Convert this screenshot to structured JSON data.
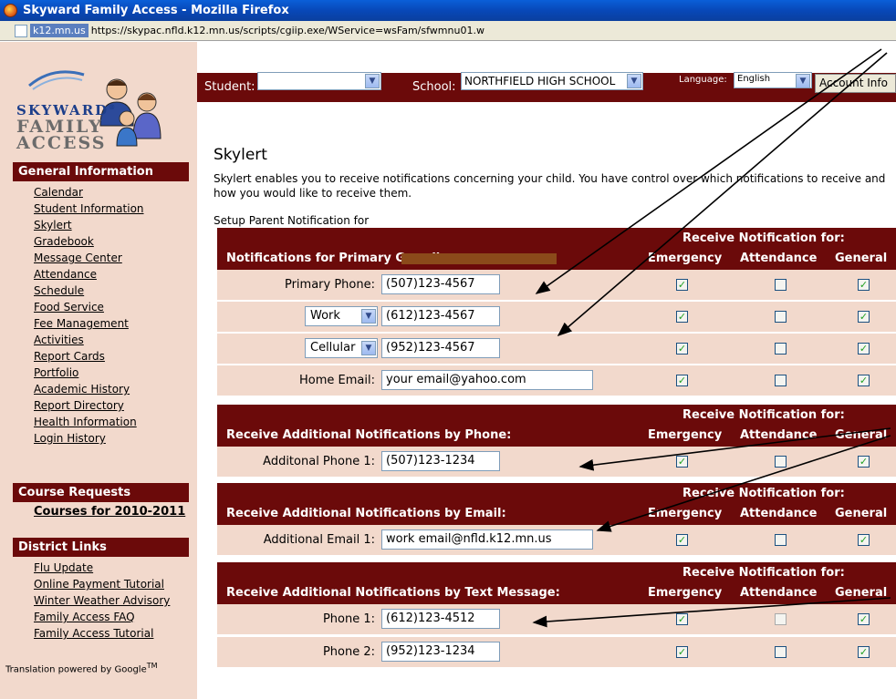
{
  "window": {
    "title": "Skyward Family Access - Mozilla Firefox"
  },
  "address": {
    "site": "k12.mn.us",
    "url": "https://skypac.nfld.k12.mn.us/scripts/cgiip.exe/WService=wsFam/sfwmnu01.w"
  },
  "logo": {
    "line1": "SKYWARD",
    "line2": "FAMILY",
    "line3": "ACCESS",
    "reg": "®"
  },
  "topbar": {
    "student_label": "Student:",
    "student_value": "",
    "school_label": "School:",
    "school_value": "NORTHFIELD HIGH SCHOOL",
    "language_label": "Language:",
    "language_value": "English",
    "account_label": "Account Info"
  },
  "sidebar": {
    "general": {
      "title": "General Information",
      "items": [
        "Calendar",
        "Student Information",
        "Skylert",
        "Gradebook",
        "Message Center",
        "Attendance",
        "Schedule",
        "Food Service",
        "Fee Management",
        "Activities",
        "Report Cards",
        "Portfolio",
        "Academic History",
        "Report Directory",
        "Health Information",
        "Login History"
      ]
    },
    "course_requests": {
      "title": "Course Requests",
      "link": "Courses for 2010-2011"
    },
    "district": {
      "title": "District Links",
      "items": [
        "Flu Update",
        "Online Payment Tutorial",
        "Winter Weather Advisory",
        "Family Access FAQ",
        "Family Access Tutorial"
      ]
    },
    "powered_by": "Translation powered by Google",
    "tm": "TM"
  },
  "main": {
    "title": "Skylert",
    "intro": "Skylert enables you to receive notifications concerning your child.   You have control over which notifications to receive and how you would like to receive them.",
    "setup_label": "Setup Parent Notification for",
    "receive_for": "Receive Notification for:",
    "col_emergency": "Emergency",
    "col_attendance": "Attendance",
    "col_general": "General",
    "sections": [
      {
        "header": "Notifications for Primary Guardian:",
        "rows": [
          {
            "label": "Primary Phone:",
            "value": "(507)123-4567",
            "emergency": true,
            "attendance": false,
            "general": true
          },
          {
            "select": "Work",
            "value": "(612)123-4567",
            "emergency": true,
            "attendance": false,
            "general": true
          },
          {
            "select": "Cellular",
            "value": "(952)123-4567",
            "emergency": true,
            "attendance": false,
            "general": true
          },
          {
            "label": "Home Email:",
            "value": "your email@yahoo.com",
            "emergency": true,
            "attendance": false,
            "general": true
          }
        ]
      },
      {
        "header": "Receive Additional Notifications by Phone:",
        "rows": [
          {
            "label": "Additonal Phone 1:",
            "value": "(507)123-1234",
            "emergency": true,
            "attendance": false,
            "general": true
          }
        ]
      },
      {
        "header": "Receive Additional Notifications by Email:",
        "rows": [
          {
            "label": "Additional Email 1:",
            "value": "work email@nfld.k12.mn.us",
            "emergency": true,
            "attendance": false,
            "general": true
          }
        ]
      },
      {
        "header": "Receive Additional Notifications by Text Message:",
        "rows": [
          {
            "label": "Phone 1:",
            "value": "(612)123-4512",
            "emergency": true,
            "attendance": false,
            "general": true
          },
          {
            "label": "Phone 2:",
            "value": "(952)123-1234",
            "emergency": true,
            "attendance": false,
            "general": true
          }
        ]
      }
    ]
  },
  "colors": {
    "maroon": "#6b0a0a",
    "row_bg": "#f2d9cc",
    "check": "#21a121"
  }
}
